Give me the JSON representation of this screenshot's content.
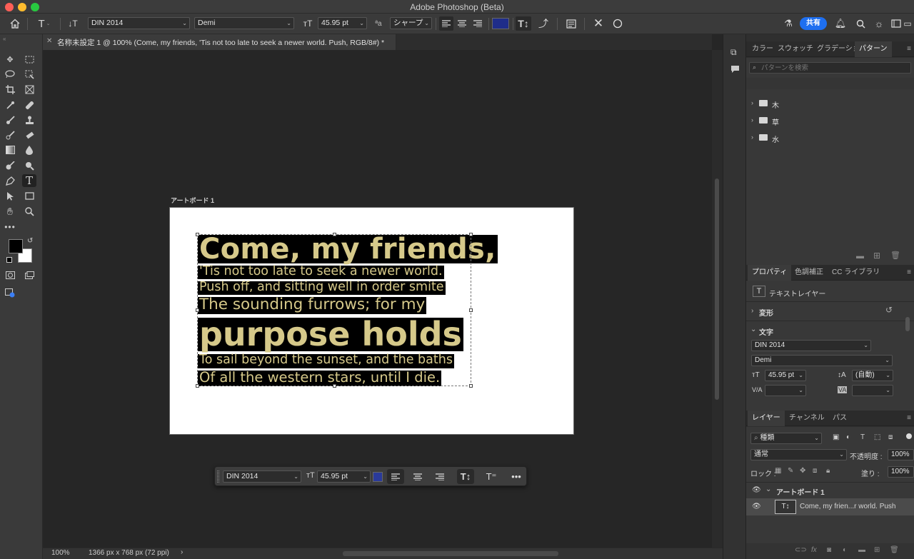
{
  "app": {
    "title": "Adobe Photoshop (Beta)"
  },
  "options_bar": {
    "font_family": "DIN 2014",
    "font_style": "Demi",
    "font_size": "45.95 pt",
    "aa_label": "aa",
    "antialias": "シャープ",
    "share_label": "共有",
    "text_color": "#1f2d8a"
  },
  "document": {
    "tab_title": "名称未設定 1 @ 100% (Come, my friends, 'Tis not too late to seek a newer world. Push, RGB/8#) *",
    "artboard_label": "アートボード 1",
    "lines": [
      "Come, my friends,",
      "'Tis not too late to seek a newer world.",
      "Push off, and sitting well in order smite",
      "The sounding furrows; for my",
      "purpose holds",
      "To sail beyond the sunset, and the baths",
      "Of all the western stars, until I die."
    ],
    "text_fill": "#d6c98a",
    "highlight": "#000000"
  },
  "context_bar": {
    "font_family": "DIN 2014",
    "font_size": "45.95 pt",
    "color": "#2a3a9a"
  },
  "status_bar": {
    "zoom": "100%",
    "dimensions": "1366 px x 768 px (72 ppi)"
  },
  "panels": {
    "top_tabs": [
      "カラー",
      "スウォッチ",
      "グラデーショ",
      "パターン"
    ],
    "pattern_search_placeholder": "パターンを検索",
    "pattern_folders": [
      "木",
      "草",
      "水"
    ],
    "mid_tabs": [
      "プロパティ",
      "色調補正",
      "CC ライブラリ"
    ],
    "text_layer_label": "テキストレイヤー",
    "transform_label": "変形",
    "type_label": "文字",
    "prop_font_family": "DIN 2014",
    "prop_font_style": "Demi",
    "prop_font_size": "45.95 pt",
    "prop_leading": "(自動)",
    "kerning_label": "V/A",
    "layer_tabs": [
      "レイヤー",
      "チャンネル",
      "パス"
    ],
    "filter_kind": "種類",
    "blend_mode": "通常",
    "opacity_label": "不透明度 :",
    "opacity_value": "100%",
    "lock_label": "ロック :",
    "fill_label": "塗り :",
    "fill_value": "100%",
    "artboard_layer": "アートボード 1",
    "text_layer_name": "Come, my frien...r world. Push"
  }
}
